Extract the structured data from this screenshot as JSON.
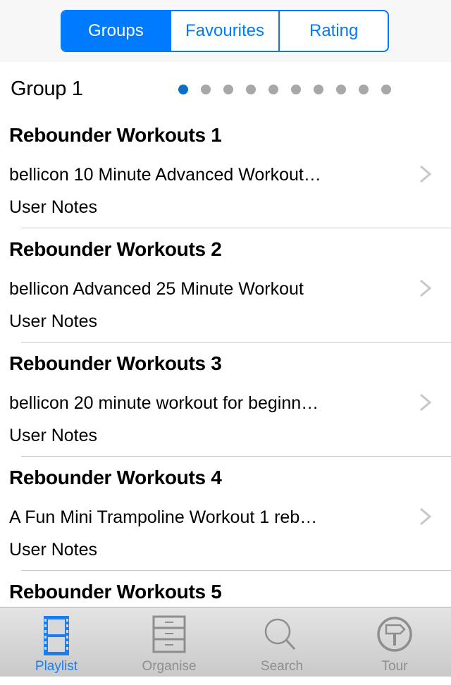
{
  "segmented_control": {
    "segments": [
      {
        "label": "Groups",
        "active": true
      },
      {
        "label": "Favourites",
        "active": false
      },
      {
        "label": "Rating",
        "active": false
      }
    ]
  },
  "group": {
    "title": "Group 1",
    "page_count": 10,
    "current_page": 1
  },
  "items": [
    {
      "title": "Rebounder Workouts 1",
      "subtitle": "bellicon 10 Minute Advanced Workout…",
      "notes": "User Notes"
    },
    {
      "title": "Rebounder Workouts 2",
      "subtitle": "bellicon Advanced 25 Minute Workout",
      "notes": "User Notes"
    },
    {
      "title": "Rebounder Workouts 3",
      "subtitle": "bellicon 20 minute workout for beginn…",
      "notes": "User Notes"
    },
    {
      "title": "Rebounder Workouts 4",
      "subtitle": "A Fun Mini Trampoline Workout  1 reb…",
      "notes": "User Notes"
    },
    {
      "title": "Rebounder Workouts 5",
      "subtitle": "",
      "notes": ""
    }
  ],
  "tabbar": {
    "tabs": [
      {
        "label": "Playlist",
        "icon": "film-strip-icon",
        "active": true
      },
      {
        "label": "Organise",
        "icon": "file-cabinet-icon",
        "active": false
      },
      {
        "label": "Search",
        "icon": "search-icon",
        "active": false
      },
      {
        "label": "Tour",
        "icon": "signpost-icon",
        "active": false
      }
    ]
  },
  "colors": {
    "accent": "#007aff",
    "active_dot": "#0a6fc9",
    "inactive_dot": "#a8a8a8",
    "inactive_tab": "#8e8e8e",
    "chevron": "#c7c7cc"
  }
}
